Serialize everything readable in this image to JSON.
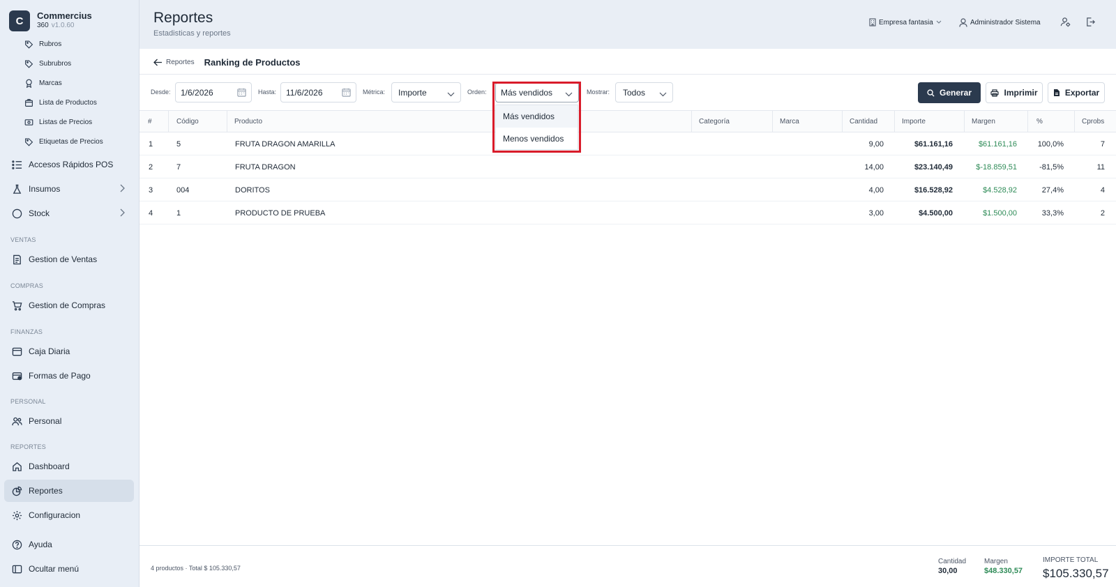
{
  "app": {
    "logo_letter": "C",
    "name": "Commercius",
    "sub": "360",
    "version": "v1.0.60"
  },
  "sidebar": {
    "subitems": [
      {
        "label": "Rubros",
        "icon": "tag-icon"
      },
      {
        "label": "Subrubros",
        "icon": "tag-icon"
      },
      {
        "label": "Marcas",
        "icon": "award-icon"
      },
      {
        "label": "Lista de Productos",
        "icon": "box-icon"
      },
      {
        "label": "Listas de Precios",
        "icon": "money-icon"
      },
      {
        "label": "Etiquetas de Precios",
        "icon": "tag-icon"
      }
    ],
    "items": [
      {
        "label": "Accesos Rápidos POS",
        "icon": "list-icon"
      },
      {
        "label": "Insumos",
        "icon": "flask-icon"
      },
      {
        "label": "Stock",
        "icon": "circle-icon"
      },
      {
        "label": "Gestion de Ventas",
        "icon": "receipt-icon"
      },
      {
        "label": "Gestion de Compras",
        "icon": "cart-icon"
      },
      {
        "label": "Caja Diaria",
        "icon": "register-icon"
      },
      {
        "label": "Formas de Pago",
        "icon": "card-icon"
      },
      {
        "label": "Personal",
        "icon": "users-icon"
      },
      {
        "label": "Dashboard",
        "icon": "home-icon"
      },
      {
        "label": "Reportes",
        "icon": "chart-icon"
      },
      {
        "label": "Configuracion",
        "icon": "gear-icon"
      },
      {
        "label": "Ayuda",
        "icon": "help-icon"
      },
      {
        "label": "Ocultar menú",
        "icon": "sidebar-icon"
      }
    ],
    "sections": {
      "ventas": "VENTAS",
      "compras": "COMPRAS",
      "finanzas": "FINANZAS",
      "personal": "PERSONAL",
      "reportes": "REPORTES"
    }
  },
  "header": {
    "title": "Reportes",
    "subtitle": "Estadisticas y reportes",
    "company": "Empresa fantasia",
    "user": "Administrador Sistema"
  },
  "breadcrumb": {
    "back": "Reportes",
    "title": "Ranking de Productos"
  },
  "filters": {
    "desde_label": "Desde:",
    "desde_value": "1/6/2026",
    "hasta_label": "Hasta:",
    "hasta_value": "11/6/2026",
    "metrica_label": "Métrica:",
    "metrica_value": "Importe",
    "orden_label": "Orden:",
    "orden_value": "Más vendidos",
    "orden_options": [
      "Más vendidos",
      "Menos vendidos"
    ],
    "mostrar_label": "Mostrar:",
    "mostrar_value": "Todos"
  },
  "actions": {
    "generar": "Generar",
    "imprimir": "Imprimir",
    "exportar": "Exportar"
  },
  "table": {
    "headers": [
      "#",
      "Código",
      "Producto",
      "Categoría",
      "Marca",
      "Cantidad",
      "Importe",
      "Margen",
      "%",
      "Cprobs"
    ],
    "rows": [
      [
        "1",
        "5",
        "FRUTA DRAGON AMARILLA",
        "",
        "",
        "9,00",
        "$61.161,16",
        "$61.161,16",
        "100,0%",
        "7"
      ],
      [
        "2",
        "7",
        "FRUTA DRAGON",
        "",
        "",
        "14,00",
        "$23.140,49",
        "$-18.859,51",
        "-81,5%",
        "11"
      ],
      [
        "3",
        "004",
        "DORITOS",
        "",
        "",
        "4,00",
        "$16.528,92",
        "$4.528,92",
        "27,4%",
        "4"
      ],
      [
        "4",
        "1",
        "PRODUCTO DE PRUEBA",
        "",
        "",
        "3,00",
        "$4.500,00",
        "$1.500,00",
        "33,3%",
        "2"
      ]
    ]
  },
  "footer": {
    "summary": "4 productos · Total $ 105.330,57",
    "cantidad_label": "Cantidad",
    "cantidad_value": "30,00",
    "margen_label": "Margen",
    "margen_value": "$48.330,57",
    "total_label": "IMPORTE TOTAL",
    "total_value": "$105.330,57"
  },
  "colors": {
    "primary": "#2b3a4e",
    "sidebar_bg": "#e8eef6",
    "positive": "#2e8b57",
    "highlight": "#d91b2a"
  }
}
